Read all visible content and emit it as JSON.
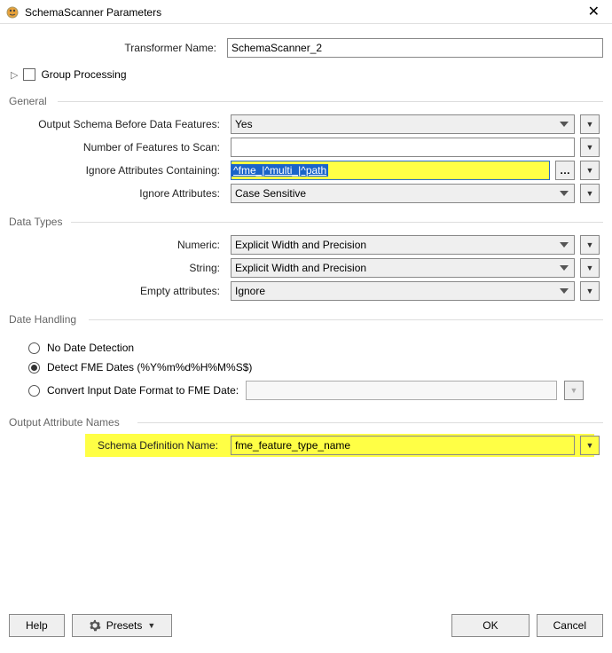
{
  "title": "SchemaScanner Parameters",
  "transformer_name_label": "Transformer Name:",
  "transformer_name_value": "SchemaScanner_2",
  "group_processing_label": "Group Processing",
  "sections": {
    "general": {
      "title": "General",
      "output_before_label": "Output Schema Before Data Features:",
      "output_before_value": "Yes",
      "num_features_label": "Number of Features to Scan:",
      "num_features_value": "",
      "ignore_containing_label": "Ignore Attributes Containing:",
      "ignore_containing_value": "^fme_|^multi_|^path",
      "ignore_attrs_label": "Ignore Attributes:",
      "ignore_attrs_value": "Case Sensitive"
    },
    "data_types": {
      "title": "Data Types",
      "numeric_label": "Numeric:",
      "numeric_value": "Explicit Width and Precision",
      "string_label": "String:",
      "string_value": "Explicit Width and Precision",
      "empty_label": "Empty attributes:",
      "empty_value": "Ignore"
    },
    "date_handling": {
      "title": "Date Handling",
      "opt1": "No Date Detection",
      "opt2": "Detect FME Dates (%Y%m%d%H%M%S$)",
      "opt3": "Convert Input Date Format to FME Date:"
    },
    "output_attr": {
      "title": "Output Attribute Names",
      "schema_def_label": "Schema Definition Name:",
      "schema_def_value": "fme_feature_type_name"
    }
  },
  "buttons": {
    "help": "Help",
    "presets": "Presets",
    "ok": "OK",
    "cancel": "Cancel"
  }
}
